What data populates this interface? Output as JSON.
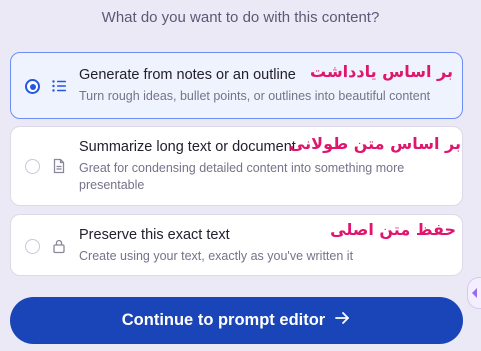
{
  "prompt": {
    "question": "What do you want to do with this content?"
  },
  "options": [
    {
      "title": "Generate from notes or an outline",
      "description": "Turn rough ideas, bullet points, or outlines into beautiful content",
      "icon": "list-icon",
      "selected": true,
      "annotation": "بر اساس یادداشت"
    },
    {
      "title": "Summarize long text or document",
      "description": "Great for condensing detailed content into something more presentable",
      "icon": "document-icon",
      "selected": false,
      "annotation": "بر اساس متن طولانی"
    },
    {
      "title": "Preserve this exact text",
      "description": "Create using your text, exactly as you've written it",
      "icon": "lock-icon",
      "selected": false,
      "annotation": "حفظ متن اصلی"
    }
  ],
  "actions": {
    "continue_label": "Continue to prompt editor",
    "continue_icon": "arrow-right-icon"
  },
  "colors": {
    "accent": "#1a45b8",
    "selected_border": "#6d8ef5",
    "annotation": "#e0156d"
  }
}
